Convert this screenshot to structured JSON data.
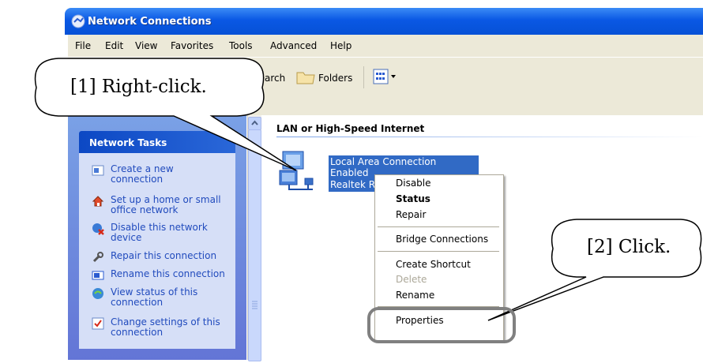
{
  "window": {
    "title": "Network Connections"
  },
  "menu": [
    "File",
    "Edit",
    "View",
    "Favorites",
    "Tools",
    "Advanced",
    "Help"
  ],
  "toolbar": {
    "search_label": "Search",
    "folders_label": "Folders"
  },
  "tasks": {
    "header": "Network Tasks",
    "items": [
      {
        "line1": "Create a new",
        "line2": "connection",
        "icon": "create-connection-icon"
      },
      {
        "line1": "Set up a home or small",
        "line2": "office network",
        "icon": "home-network-icon"
      },
      {
        "line1": "Disable this network",
        "line2": "device",
        "icon": "disable-device-icon"
      },
      {
        "line1": "Repair this connection",
        "line2": "",
        "icon": "repair-icon"
      },
      {
        "line1": "Rename this connection",
        "line2": "",
        "icon": "rename-icon"
      },
      {
        "line1": "View status of this",
        "line2": "connection",
        "icon": "status-icon"
      },
      {
        "line1": "Change settings of this",
        "line2": "connection",
        "icon": "settings-icon"
      }
    ]
  },
  "content": {
    "group_title": "LAN or High-Speed Internet",
    "connection": {
      "name": "Local Area Connection",
      "status": "Enabled",
      "device": "Realtek RT"
    }
  },
  "context_menu": {
    "disable": "Disable",
    "status": "Status",
    "repair": "Repair",
    "bridge": "Bridge Connections",
    "shortcut": "Create Shortcut",
    "delete": "Delete",
    "rename": "Rename",
    "properties": "Properties"
  },
  "callouts": {
    "first": "[1] Right-click.",
    "second": "[2] Click."
  },
  "colors": {
    "titlebar": "#0a58e4",
    "taskpane": "#7aa1e6",
    "selection": "#316ac5",
    "link": "#214bbd"
  }
}
